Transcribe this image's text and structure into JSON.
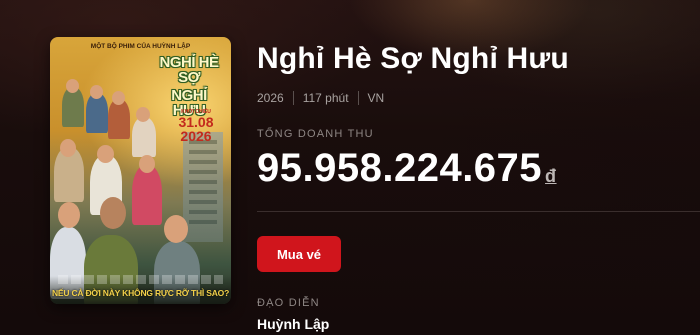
{
  "movie": {
    "title": "Nghỉ Hè Sợ Nghỉ Hưu",
    "year": "2026",
    "duration": "117 phút",
    "country": "VN",
    "revenue_label": "TỔNG DOANH THU",
    "revenue_value": "95.958.224.675",
    "currency_symbol": "đ",
    "buy_label": "Mua vé",
    "director_label": "ĐẠO DIỄN",
    "director": "Huỳnh Lập"
  },
  "poster": {
    "top_tagline": "MỘT BỘ PHIM CỦA HUỲNH LẬP",
    "title_line1": "NGHỈ HÈ SỢ",
    "title_line2": "NGHỈ HƯU",
    "release_label": "KHỞI CHIẾU",
    "release_date_1": "31.08",
    "release_date_2": "2026",
    "bottom_tagline": "NẾU CẢ ĐỜI NÀY KHÔNG RỰC RỠ THÌ SAO?"
  },
  "colors": {
    "background": "#170c0b",
    "accent_red": "#d0151c",
    "text_primary": "#ffffff",
    "text_muted": "#a8a2a0",
    "poster_tagline": "#f2d04a"
  }
}
